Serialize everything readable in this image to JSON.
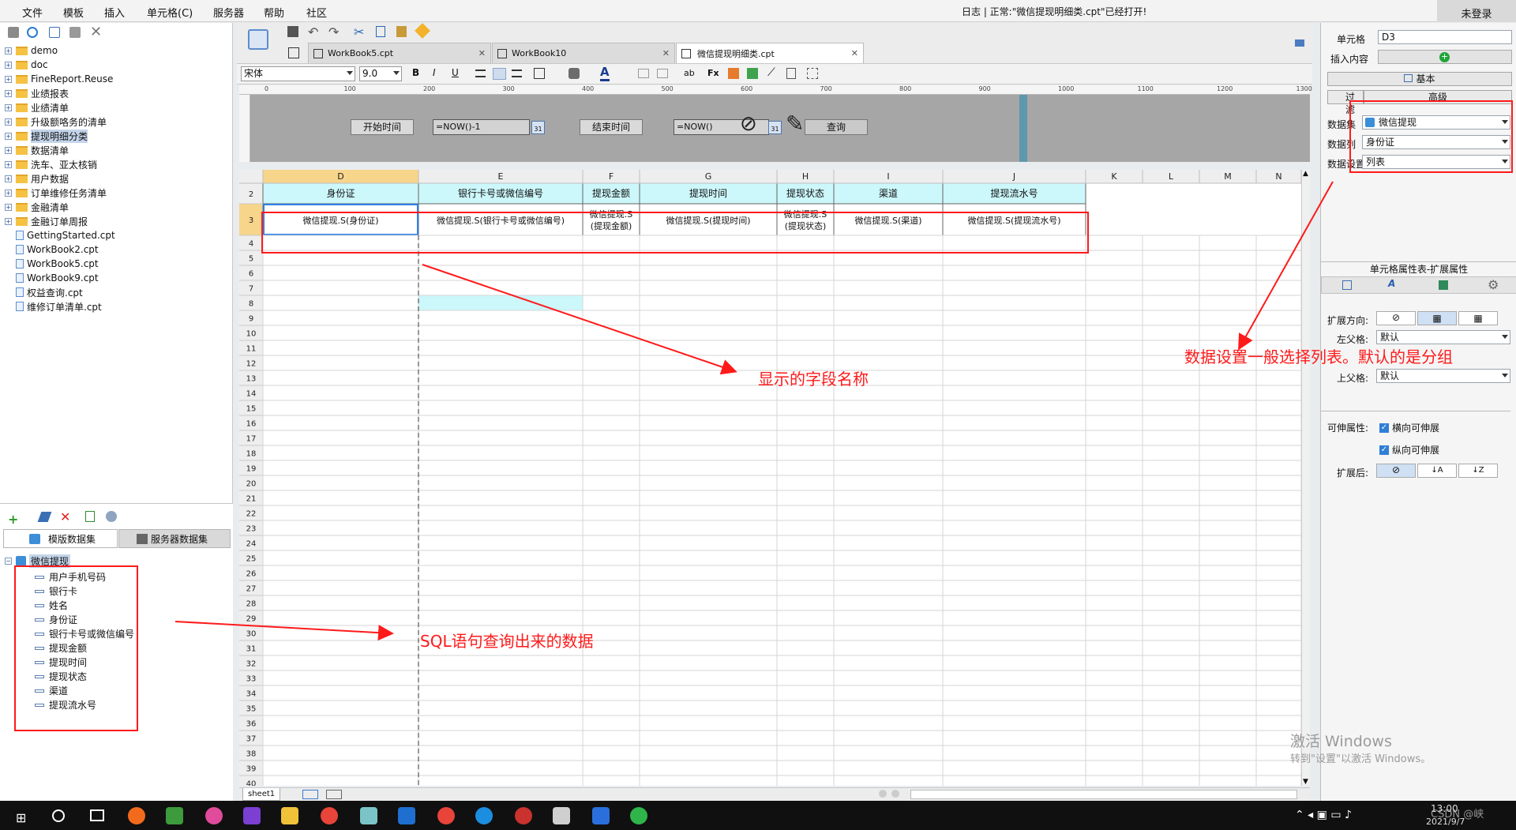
{
  "menu": [
    "文件",
    "模板",
    "插入",
    "单元格(C)",
    "服务器",
    "帮助",
    "社区"
  ],
  "status_text": "日志 | 正常:\"微信提现明细类.cpt\"已经打开!",
  "login": "未登录",
  "tree": [
    {
      "label": "demo",
      "type": "folder"
    },
    {
      "label": "doc",
      "type": "folder"
    },
    {
      "label": "FineReport.Reuse",
      "type": "folder"
    },
    {
      "label": "业绩报表",
      "type": "folder"
    },
    {
      "label": "业绩清单",
      "type": "folder"
    },
    {
      "label": "升级额咯务的清单",
      "type": "folder"
    },
    {
      "label": "提现明细分类",
      "type": "folder",
      "selected": true
    },
    {
      "label": "数据清单",
      "type": "folder"
    },
    {
      "label": "洗车、亚太核销",
      "type": "folder"
    },
    {
      "label": "用户数据",
      "type": "folder"
    },
    {
      "label": "订单维修任务清单",
      "type": "folder"
    },
    {
      "label": "金融清单",
      "type": "folder"
    },
    {
      "label": "金融订单周报",
      "type": "folder"
    },
    {
      "label": "GettingStarted.cpt",
      "type": "file"
    },
    {
      "label": "WorkBook2.cpt",
      "type": "file"
    },
    {
      "label": "WorkBook5.cpt",
      "type": "file"
    },
    {
      "label": "WorkBook9.cpt",
      "type": "file"
    },
    {
      "label": "权益查询.cpt",
      "type": "file"
    },
    {
      "label": "维修订单清单.cpt",
      "type": "file"
    }
  ],
  "dataset_tabs": {
    "template": "模版数据集",
    "server": "服务器数据集"
  },
  "dataset": {
    "name": "微信提现",
    "fields": [
      "用户手机号码",
      "银行卡",
      "姓名",
      "身份证",
      "银行卡号或微信编号",
      "提现金额",
      "提现时间",
      "提现状态",
      "渠道",
      "提现流水号"
    ]
  },
  "tabs": [
    "WorkBook5.cpt",
    "WorkBook10",
    "微信提现明细类.cpt"
  ],
  "font": {
    "name": "宋体",
    "size": "9.0"
  },
  "params": {
    "start_label": "开始时间",
    "start_value": "=NOW()-1",
    "end_label": "结束时间",
    "end_value": "=NOW()",
    "query": "查询",
    "calendar": "31"
  },
  "ruler": [
    "0",
    "100",
    "200",
    "300",
    "400",
    "500",
    "600",
    "700",
    "800",
    "900",
    "1000",
    "1100",
    "1200",
    "1300"
  ],
  "columns": [
    "D",
    "E",
    "F",
    "G",
    "H",
    "I",
    "J",
    "K",
    "L",
    "M",
    "N"
  ],
  "row_headers": [
    "2",
    "3",
    "4",
    "5",
    "6",
    "7",
    "8",
    "9",
    "10",
    "11",
    "12",
    "13",
    "14",
    "15",
    "16",
    "17",
    "18",
    "19",
    "20",
    "21",
    "22",
    "23",
    "24",
    "25",
    "26",
    "27",
    "28",
    "29",
    "30",
    "31",
    "32",
    "33",
    "34",
    "35",
    "36",
    "37",
    "38",
    "39",
    "40"
  ],
  "header_row": [
    "身份证",
    "银行卡号或微信编号",
    "提现金额",
    "提现时间",
    "提现状态",
    "渠道",
    "提现流水号"
  ],
  "data_row": [
    "微信提现.S(身份证)",
    "微信提现.S(银行卡号或微信编号)",
    "微信提现.S(提现金额)",
    "微信提现.S(提现时间)",
    "微信提现.S(提现状态)",
    "微信提现.S(渠道)",
    "微信提现.S(提现流水号)"
  ],
  "sheet_tab": "sheet1",
  "right": {
    "cell_label": "单元格",
    "cell_value": "D3",
    "insert_label": "插入内容",
    "basic": "基本",
    "filter": "过滤",
    "advanced": "高级",
    "dataset_label": "数据集",
    "dataset_value": "微信提现",
    "column_label": "数据列",
    "column_value": "身份证",
    "setting_label": "数据设置",
    "setting_value": "列表",
    "ext_title": "单元格属性表-扩展属性",
    "direction_label": "扩展方向:",
    "left_parent_label": "左父格:",
    "left_parent_value": "默认",
    "up_parent_label": "上父格:",
    "up_parent_value": "默认",
    "stretch_label": "可伸属性:",
    "horizontal": "横向可伸展",
    "vertical": "纵向可伸展",
    "after_label": "扩展后:"
  },
  "annotations": {
    "a1": "显示的字段名称",
    "a2": "数据设置一般选择列表。默认的是分组",
    "a3": "SQL语句查询出来的数据"
  },
  "watermark": {
    "line1": "激活 Windows",
    "line2": "转到\"设置\"以激活 Windows。"
  },
  "clock": {
    "time": "13:00",
    "date": "2021/9/7",
    "csdn": "CSDN @峡"
  }
}
